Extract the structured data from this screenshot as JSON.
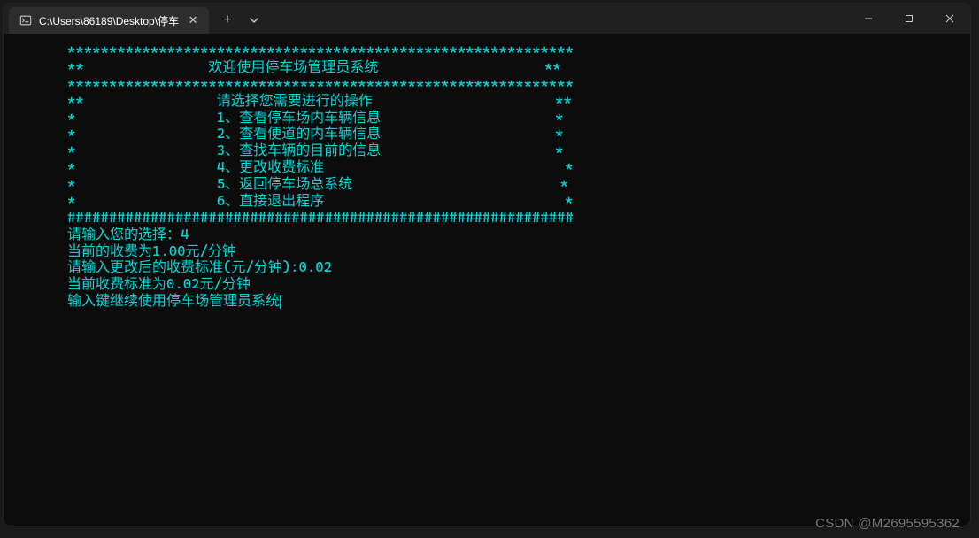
{
  "titlebar": {
    "tab_title": "C:\\Users\\86189\\Desktop\\停车",
    "tab_icon": "terminal-icon",
    "close_label": "✕",
    "new_tab_label": "+"
  },
  "terminal": {
    "lines": [
      "*************************************************************",
      "**               欢迎使用停车场管理员系统                    **",
      "*************************************************************",
      "**                请选择您需要进行的操作                      **",
      "*                 1、查看停车场内车辆信息                     *",
      "*                 2、查看便道的内车辆信息                     *",
      "*                 3、查找车辆的目前的信息                     *",
      "*                 4、更改收费标准                             *",
      "*                 5、返回停车场总系统                         *",
      "*                 6、直接退出程序                             *",
      "#############################################################",
      "请输入您的选择：4",
      "",
      "当前的收费为1.00元/分钟",
      "请输入更改后的收费标准(元/分钟):0.02",
      "当前收费标准为0.02元/分钟",
      "",
      "",
      "输入键继续使用停车场管理员系统"
    ]
  },
  "watermark": "CSDN @M2695595362"
}
